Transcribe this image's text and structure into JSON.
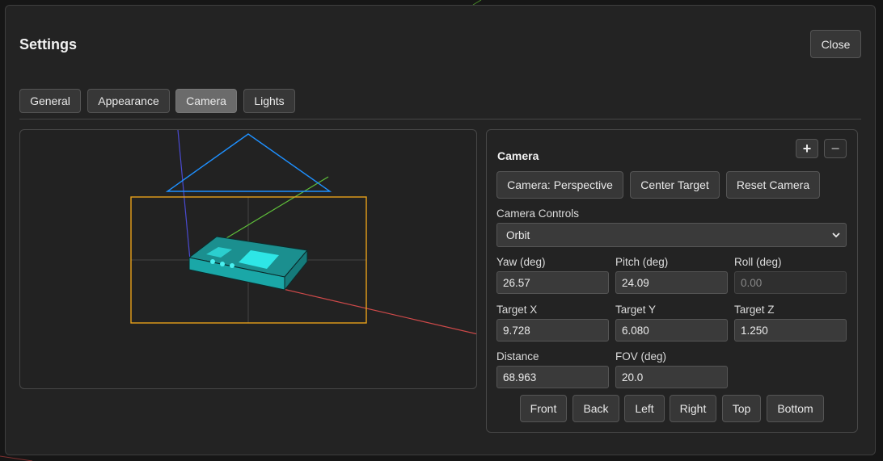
{
  "dialog": {
    "title": "Settings",
    "close_label": "Close"
  },
  "tabs": [
    {
      "label": "General",
      "active": false
    },
    {
      "label": "Appearance",
      "active": false
    },
    {
      "label": "Camera",
      "active": true
    },
    {
      "label": "Lights",
      "active": false
    }
  ],
  "camera_panel": {
    "title": "Camera",
    "add_icon": "plus-icon",
    "remove_icon": "minus-icon",
    "mode_button_label": "Camera: Perspective",
    "center_target_label": "Center Target",
    "reset_camera_label": "Reset Camera",
    "controls_label": "Camera Controls",
    "controls_value": "Orbit",
    "fields": {
      "yaw": {
        "label": "Yaw (deg)",
        "value": "26.57"
      },
      "pitch": {
        "label": "Pitch (deg)",
        "value": "24.09"
      },
      "roll": {
        "label": "Roll (deg)",
        "value": "0.00",
        "disabled": true
      },
      "target_x": {
        "label": "Target X",
        "value": "9.728"
      },
      "target_y": {
        "label": "Target Y",
        "value": "6.080"
      },
      "target_z": {
        "label": "Target Z",
        "value": "1.250"
      },
      "distance": {
        "label": "Distance",
        "value": "68.963"
      },
      "fov": {
        "label": "FOV (deg)",
        "value": "20.0"
      }
    },
    "view_buttons": [
      "Front",
      "Back",
      "Left",
      "Right",
      "Top",
      "Bottom"
    ]
  },
  "colors": {
    "axis_x": "#d04a4a",
    "axis_y": "#5fbf3a",
    "axis_z": "#4a4ad0",
    "frustum": "#1e90ff",
    "frame": "#e8a11a",
    "model": "#1fc3c3"
  }
}
